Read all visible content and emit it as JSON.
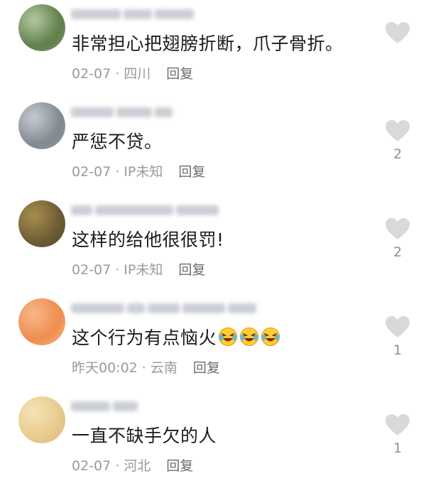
{
  "comments": [
    {
      "text": "非常担心把翅膀折断，爪子骨折。",
      "date": "02-07",
      "location": "四川",
      "reply_label": "回复",
      "likes": "",
      "emoji_count": 0,
      "avatar_colors": [
        "#5e7d4a",
        "#b7c9a3",
        "#8aa070"
      ]
    },
    {
      "text": "严惩不贷。",
      "date": "02-07",
      "location": "IP未知",
      "reply_label": "回复",
      "likes": "2",
      "emoji_count": 0,
      "avatar_colors": [
        "#7f8790",
        "#c8cdd3",
        "#9aa3ad"
      ]
    },
    {
      "text": "这样的给他很很罚!",
      "date": "02-07",
      "location": "IP未知",
      "reply_label": "回复",
      "likes": "2",
      "emoji_count": 0,
      "avatar_colors": [
        "#6b5a32",
        "#a98f52",
        "#4f4a2d"
      ]
    },
    {
      "text": "这个行为有点恼火",
      "date": "昨天00:02",
      "location": "云南",
      "reply_label": "回复",
      "likes": "1",
      "emoji_count": 3,
      "avatar_colors": [
        "#f08a4b",
        "#f6b98a",
        "#f7d3b4"
      ]
    },
    {
      "text": "一直不缺手欠的人",
      "date": "02-07",
      "location": "河北",
      "reply_label": "回复",
      "likes": "1",
      "emoji_count": 0,
      "avatar_colors": [
        "#e8c98a",
        "#f5e3b8",
        "#d9b57a"
      ]
    }
  ],
  "meta_separator": "·",
  "colors": {
    "text": "#1b1b1b",
    "meta": "#9a9a9a",
    "reply": "#6d6d6d",
    "heart": "#d9d9d9",
    "emoji": "#ffcc33"
  }
}
